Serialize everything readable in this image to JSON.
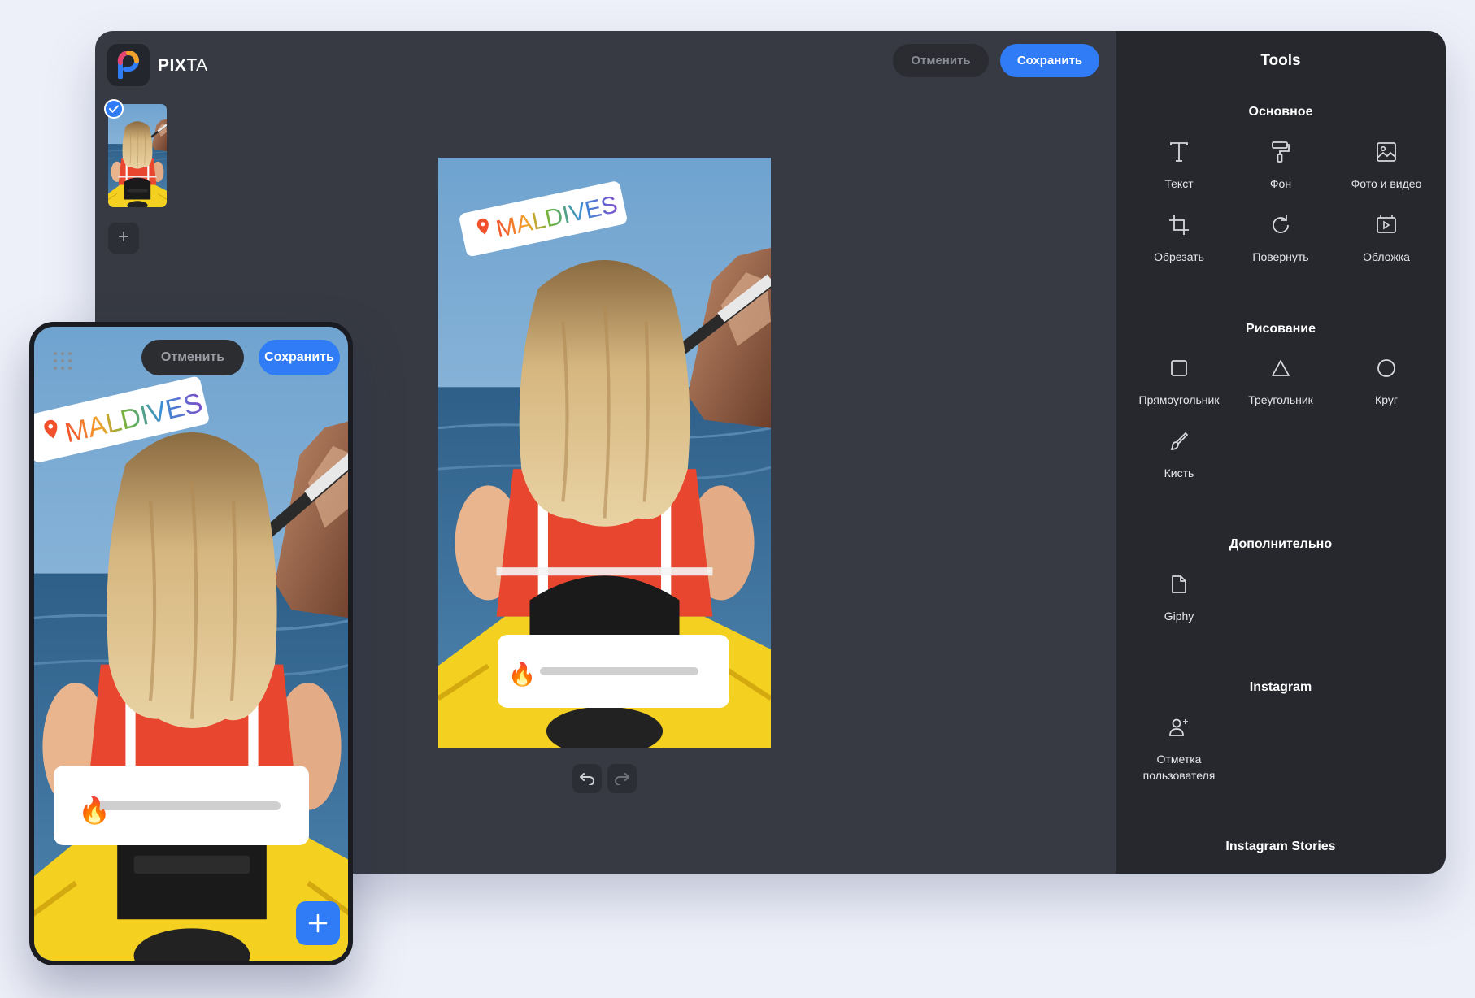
{
  "app": {
    "name_bold": "PIX",
    "name_rest": "TA"
  },
  "header": {
    "cancel_label": "Отменить",
    "save_label": "Сохранить"
  },
  "story": {
    "location_sticker": "MALDIVES",
    "slider_emoji": "🔥"
  },
  "tools": {
    "title": "Tools",
    "sections": {
      "basic": {
        "title": "Основное",
        "items": [
          {
            "label": "Текст",
            "icon": "text-icon"
          },
          {
            "label": "Фон",
            "icon": "paint-roller-icon"
          },
          {
            "label": "Фото и видео",
            "icon": "image-icon"
          },
          {
            "label": "Обрезать",
            "icon": "crop-icon"
          },
          {
            "label": "Повернуть",
            "icon": "rotate-icon"
          },
          {
            "label": "Обложка",
            "icon": "cover-icon"
          }
        ]
      },
      "drawing": {
        "title": "Рисование",
        "items": [
          {
            "label": "Прямоугольник",
            "icon": "rectangle-icon"
          },
          {
            "label": "Треугольник",
            "icon": "triangle-icon"
          },
          {
            "label": "Круг",
            "icon": "circle-icon"
          },
          {
            "label": "Кисть",
            "icon": "brush-icon"
          }
        ]
      },
      "extra": {
        "title": "Дополнительно",
        "items": [
          {
            "label": "Giphy",
            "icon": "file-icon"
          }
        ]
      },
      "instagram": {
        "title": "Instagram",
        "items": [
          {
            "label": "Отметка пользователя",
            "icon": "user-tag-icon"
          }
        ]
      },
      "stories": {
        "title": "Instagram Stories"
      }
    }
  },
  "mobile": {
    "cancel_label": "Отменить",
    "save_label": "Сохранить"
  },
  "colors": {
    "accent": "#2f7cf6",
    "editor_bg": "#373a42",
    "panel_bg": "#26282e"
  }
}
